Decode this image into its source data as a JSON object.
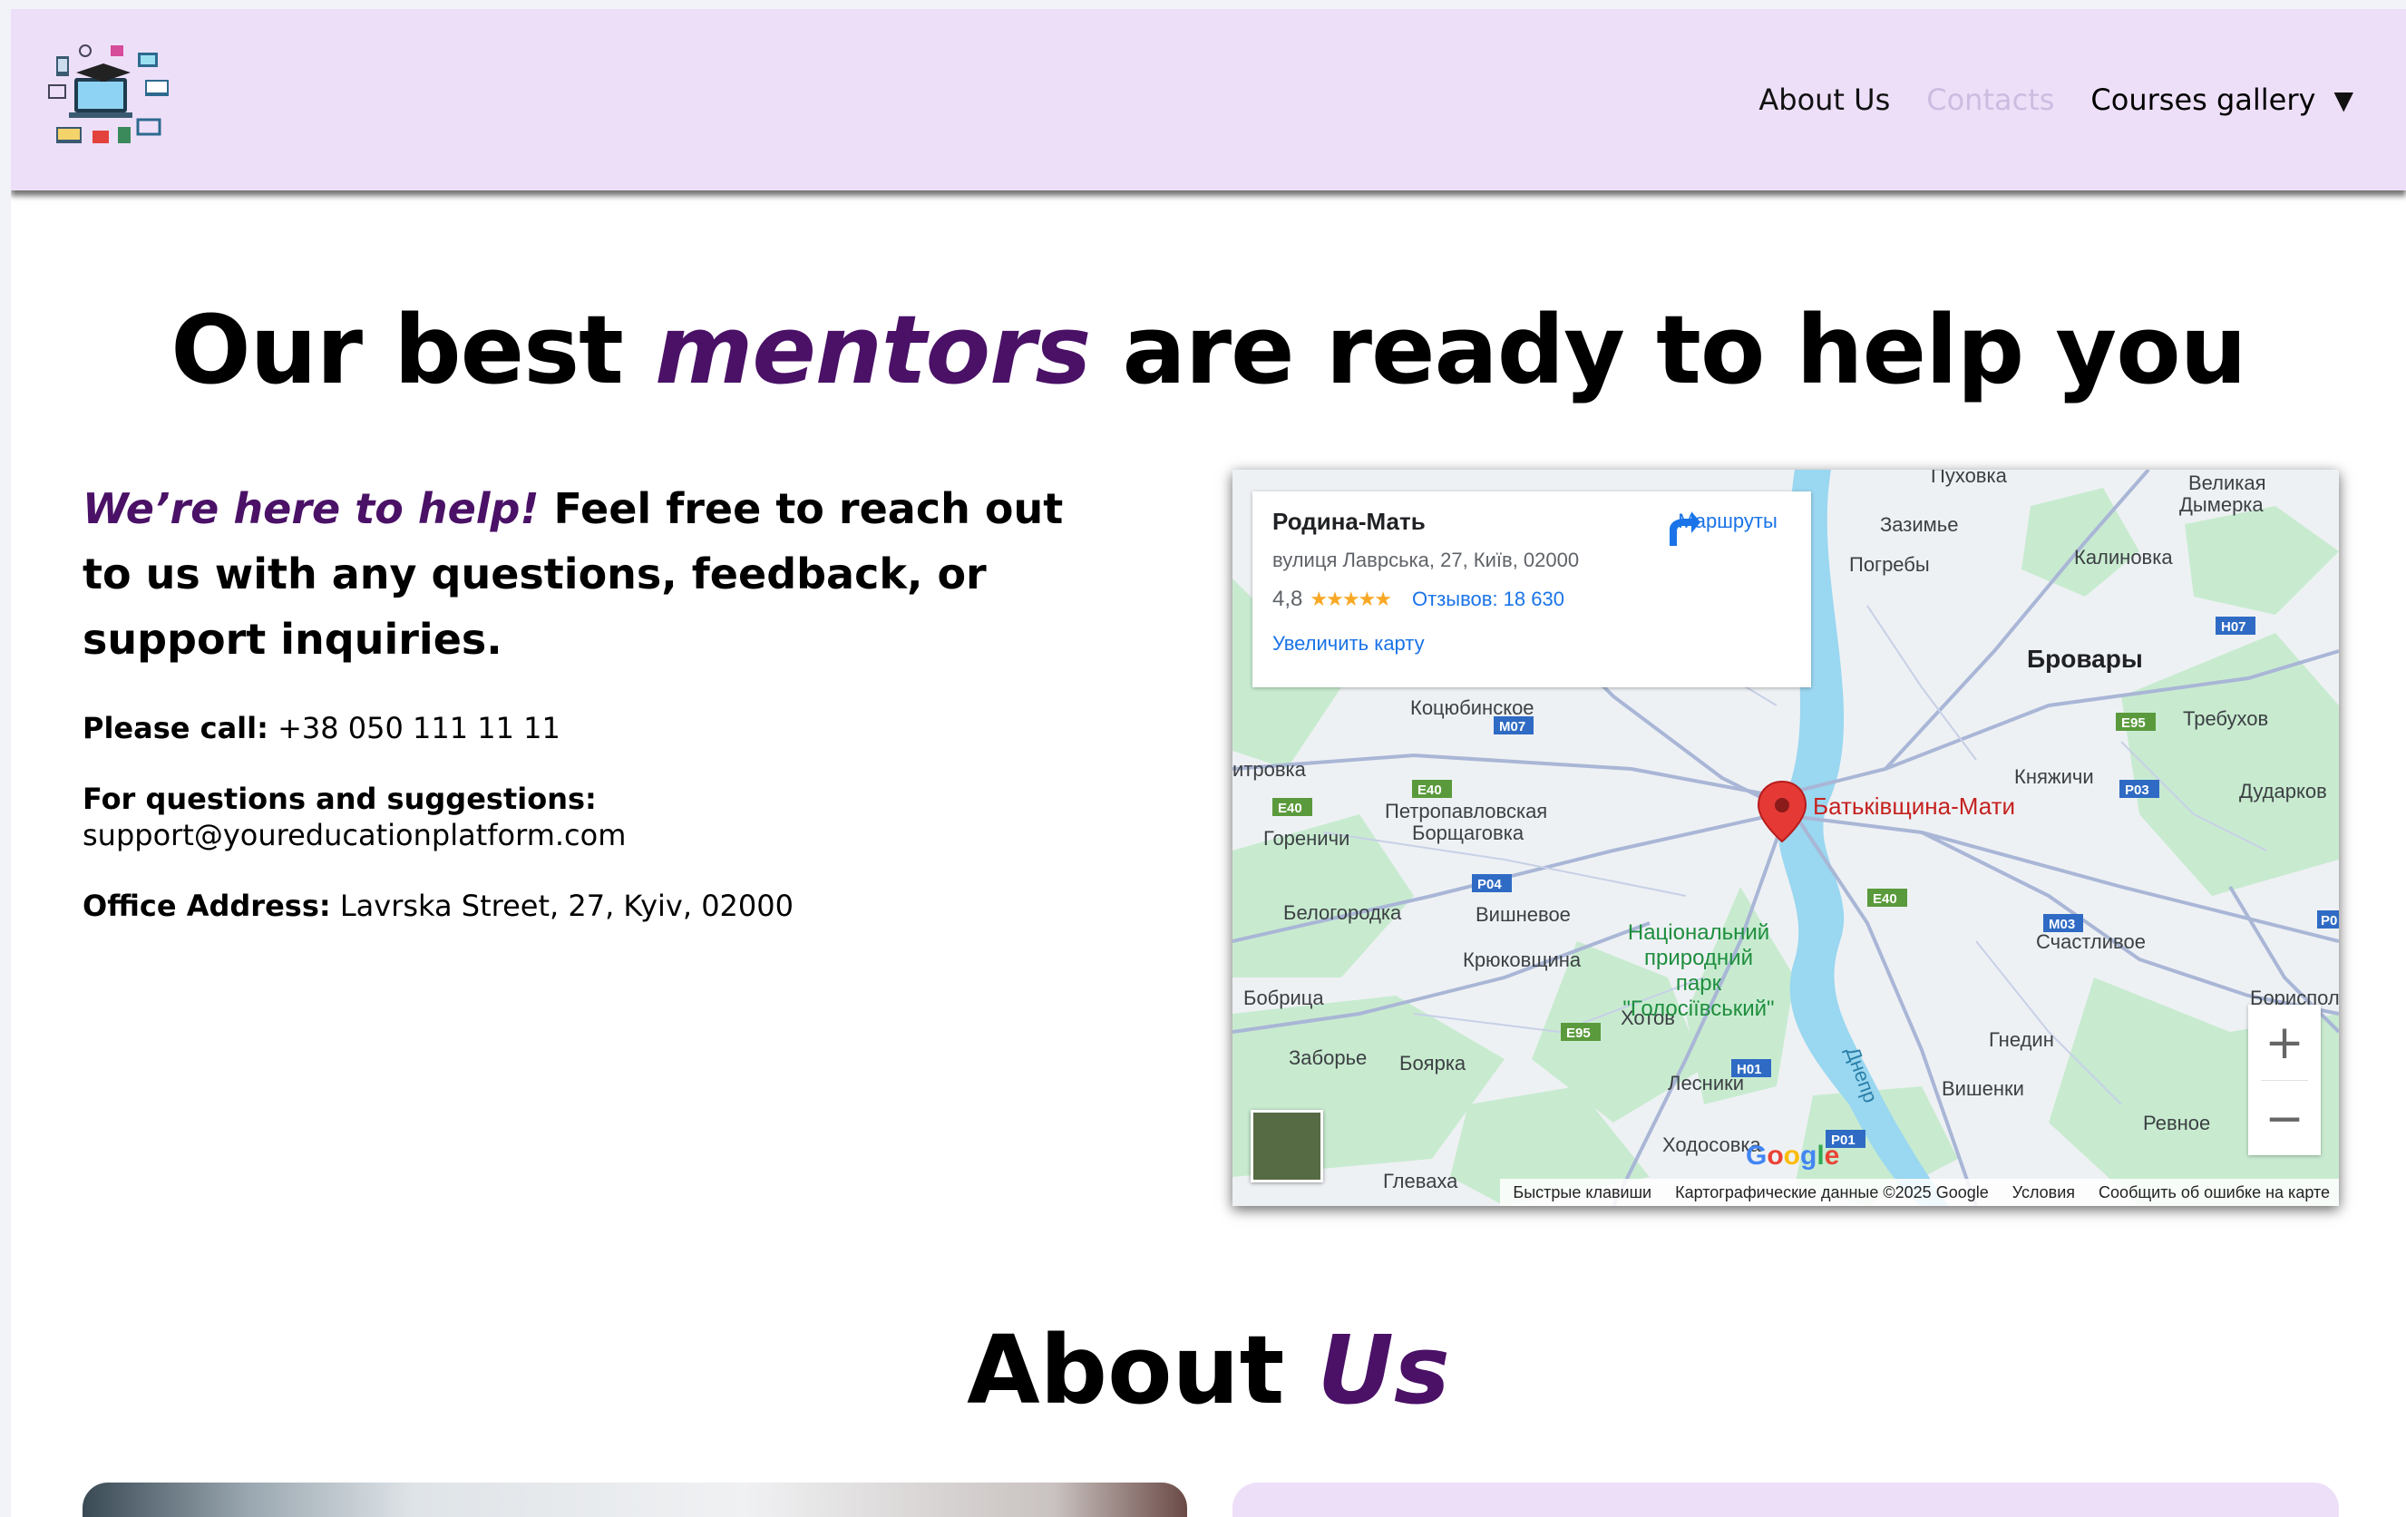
{
  "nav": {
    "about": "About Us",
    "contacts": "Contacts",
    "courses": "Courses gallery",
    "caret": "▼"
  },
  "hero": {
    "title_pre": "Our best ",
    "title_em": "mentors",
    "title_post": " are ready to help you"
  },
  "contact": {
    "lead_em": "We’re here to help!",
    "lead_rest": " Feel free to reach out to us with any questions, feedback, or support inquiries.",
    "phone_label": "Please call:",
    "phone": " +38 050 111 11 11",
    "email_label": "For questions and suggestions:",
    "email": " support@youreducationplatform.com",
    "address_label": "Office Address:",
    "address": " Lavrska Street, 27, Kyiv, 02000"
  },
  "map": {
    "place_name": "Родина-Мать",
    "place_address": "вулиця Лаврська, 27, Київ, 02000",
    "rating": "4,8",
    "stars": "★★★★★",
    "reviews": "Отзывов: 18 630",
    "enlarge": "Увеличить карту",
    "directions": "Маршруты",
    "marker_label": "Батьківщина-Мати",
    "labels": {
      "brovary": "Бровары",
      "kalinovka": "Калиновка",
      "zazimye": "Зазимье",
      "pogreby": "Погребы",
      "puhovka": "Пуховка",
      "velikaya": "Великая",
      "dymerka": "Дымерка",
      "trebuhov": "Требухов",
      "knyazhichi": "Княжичи",
      "dudarkov": "Дударков",
      "kotsyubinskoe": "Коцюбинское",
      "dmitrovka": "итровка",
      "petropavlovskaya": "Петропавловская",
      "borschagovka": "Борщаговка",
      "gorenichi": "Гореничи",
      "belogorodka": "Белогородка",
      "vishnevoe": "Вишневое",
      "kryukovschina": "Крюковщина",
      "bobritsa": "Бобрица",
      "zaborye": "Заборье",
      "boyarka": "Боярка",
      "park1": "Національний",
      "park2": "природний",
      "park3": "парк",
      "park4": "\"Голосіївський\"",
      "hotov": "Хотов",
      "lesniki": "Лесники",
      "hodosovka": "Ходосовка",
      "gnedin": "Гнедин",
      "vishenki": "Вишенки",
      "rivne": "Ревное",
      "schastlivoe": "Счастливое",
      "borispol": "Борисполь",
      "dnepr": "Днепр",
      "glevaha": "Глеваха"
    },
    "roads": [
      "M07",
      "E40",
      "E40",
      "P04",
      "E95",
      "H01",
      "P01",
      "E40",
      "M03",
      "E95",
      "H07",
      "P03",
      "P0"
    ],
    "attribution": [
      "Быстрые клавиши",
      "Картографические данные ©2025 Google",
      "Условия",
      "Сообщить об ошибке на карте"
    ],
    "zoom_in": "+",
    "zoom_out": "−",
    "google": "Google"
  },
  "about": {
    "title_pre": "About ",
    "title_em": "Us"
  },
  "colors": {
    "header_bg": "#eedff9",
    "accent": "#4a1167",
    "link_blue": "#1a73e8",
    "map_green": "#c8ebd0",
    "water": "#9ad7f0"
  }
}
